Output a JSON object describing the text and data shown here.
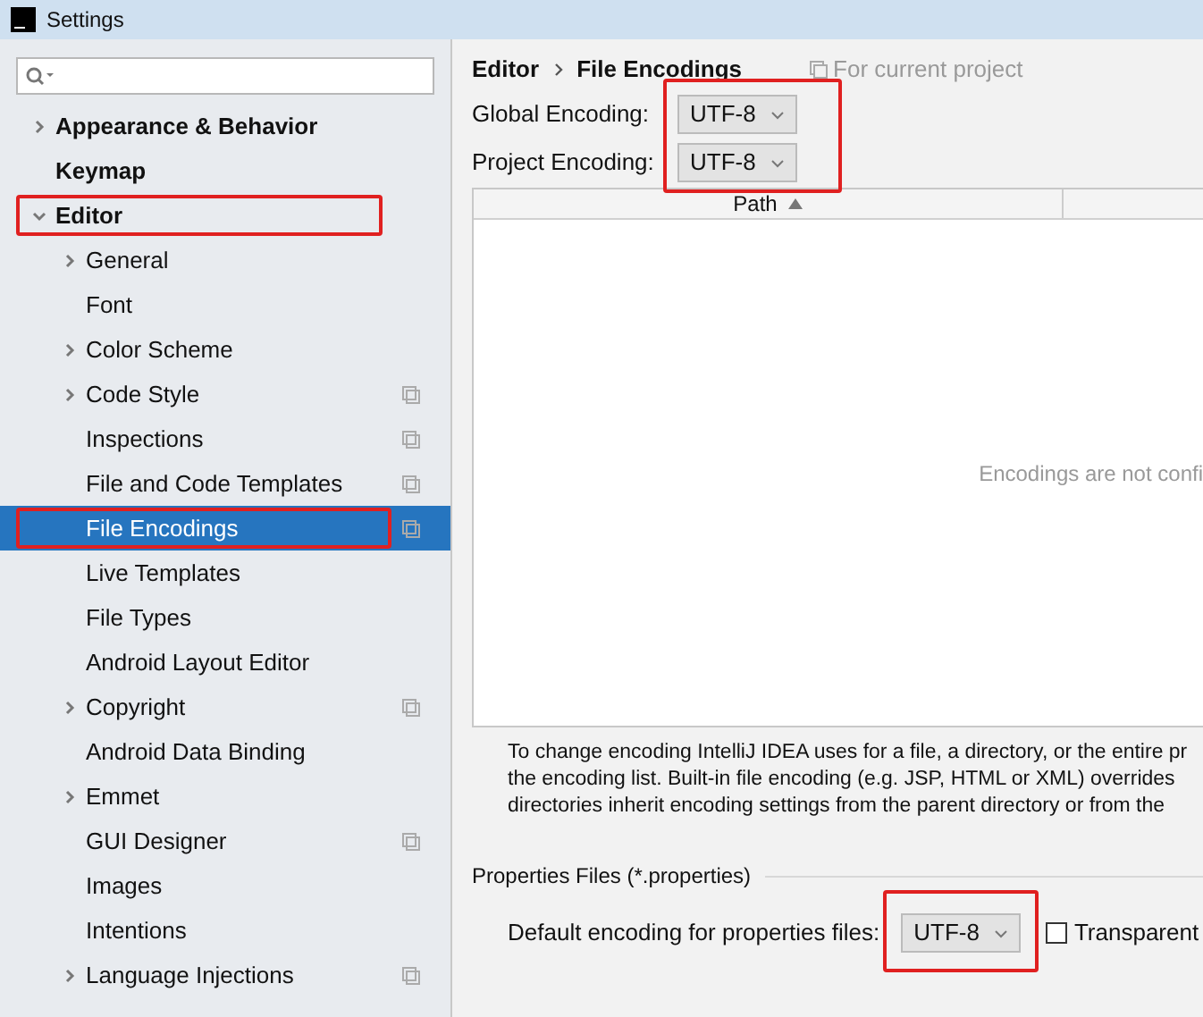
{
  "window": {
    "title": "Settings"
  },
  "tree": [
    {
      "label": "Appearance & Behavior",
      "kind": "group",
      "expanded": false,
      "selected": false,
      "project_level": false,
      "highlighted": false
    },
    {
      "label": "Keymap",
      "kind": "leaf",
      "selected": false,
      "project_level": false,
      "highlighted": false
    },
    {
      "label": "Editor",
      "kind": "group",
      "expanded": true,
      "selected": false,
      "project_level": false,
      "highlighted": true,
      "children": [
        {
          "label": "General",
          "kind": "group",
          "expanded": false,
          "selected": false,
          "project_level": false,
          "highlighted": false
        },
        {
          "label": "Font",
          "kind": "leaf",
          "selected": false,
          "project_level": false,
          "highlighted": false
        },
        {
          "label": "Color Scheme",
          "kind": "group",
          "expanded": false,
          "selected": false,
          "project_level": false,
          "highlighted": false
        },
        {
          "label": "Code Style",
          "kind": "group",
          "expanded": false,
          "selected": false,
          "project_level": true,
          "highlighted": false
        },
        {
          "label": "Inspections",
          "kind": "leaf",
          "selected": false,
          "project_level": true,
          "highlighted": false
        },
        {
          "label": "File and Code Templates",
          "kind": "leaf",
          "selected": false,
          "project_level": true,
          "highlighted": false
        },
        {
          "label": "File Encodings",
          "kind": "leaf",
          "selected": true,
          "project_level": true,
          "highlighted": true
        },
        {
          "label": "Live Templates",
          "kind": "leaf",
          "selected": false,
          "project_level": false,
          "highlighted": false
        },
        {
          "label": "File Types",
          "kind": "leaf",
          "selected": false,
          "project_level": false,
          "highlighted": false
        },
        {
          "label": "Android Layout Editor",
          "kind": "leaf",
          "selected": false,
          "project_level": false,
          "highlighted": false
        },
        {
          "label": "Copyright",
          "kind": "group",
          "expanded": false,
          "selected": false,
          "project_level": true,
          "highlighted": false
        },
        {
          "label": "Android Data Binding",
          "kind": "leaf",
          "selected": false,
          "project_level": false,
          "highlighted": false
        },
        {
          "label": "Emmet",
          "kind": "group",
          "expanded": false,
          "selected": false,
          "project_level": false,
          "highlighted": false
        },
        {
          "label": "GUI Designer",
          "kind": "leaf",
          "selected": false,
          "project_level": true,
          "highlighted": false
        },
        {
          "label": "Images",
          "kind": "leaf",
          "selected": false,
          "project_level": false,
          "highlighted": false
        },
        {
          "label": "Intentions",
          "kind": "leaf",
          "selected": false,
          "project_level": false,
          "highlighted": false
        },
        {
          "label": "Language Injections",
          "kind": "group",
          "expanded": false,
          "selected": false,
          "project_level": true,
          "highlighted": false
        }
      ]
    }
  ],
  "breadcrumb": [
    "Editor",
    "File Encodings"
  ],
  "scope_note": "For current project",
  "encodings": [
    {
      "label": "Global Encoding:",
      "value": "UTF-8"
    },
    {
      "label": "Project Encoding:",
      "value": "UTF-8"
    }
  ],
  "encodings_highlighted": true,
  "table": {
    "columns": [
      {
        "label": "Path"
      }
    ],
    "empty_text": "Encodings are not confi"
  },
  "description": [
    "To change encoding IntelliJ IDEA uses for a file, a directory, or the entire pr",
    "the encoding list. Built-in file encoding (e.g. JSP, HTML or XML) overrides",
    "directories inherit encoding settings from the parent directory or from the"
  ],
  "properties": {
    "title": "Properties Files (*.properties)",
    "label": "Default encoding for properties files:",
    "value": "UTF-8",
    "highlighted": true,
    "checkbox": {
      "label": "Transparent",
      "checked": false
    }
  }
}
